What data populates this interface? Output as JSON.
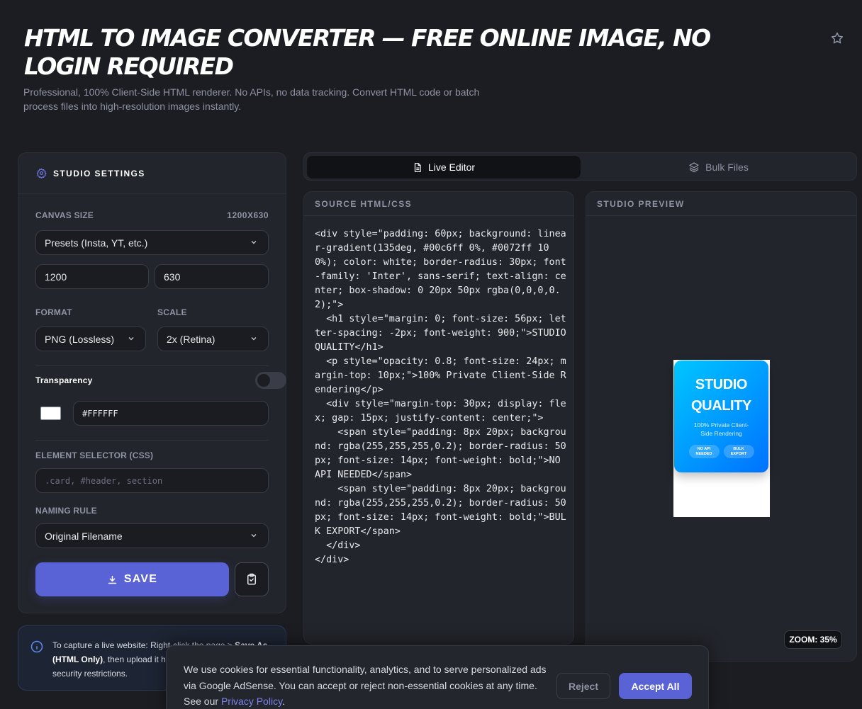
{
  "header": {
    "title": "HTML TO IMAGE CONVERTER — FREE ONLINE IMAGE, NO LOGIN REQUIRED",
    "subtitle": "Professional, 100% Client-Side HTML renderer. No APIs, no data tracking. Convert HTML code or batch process files into high-resolution images instantly.",
    "favorite_icon": "star-icon"
  },
  "settings": {
    "heading": "STUDIO SETTINGS",
    "heading_icon": "gear-icon",
    "canvas_size_label": "CANVAS SIZE",
    "canvas_size_value": "1200X630",
    "preset_select": "Presets (Insta, YT, etc.)",
    "width": "1200",
    "height": "630",
    "format_label": "FORMAT",
    "format_value": "PNG (Lossless)",
    "scale_label": "SCALE",
    "scale_value": "2x (Retina)",
    "transparency_label": "Transparency",
    "transparency_enabled": false,
    "bg_color": "#FFFFFF",
    "selector_label": "ELEMENT SELECTOR (CSS)",
    "selector_placeholder": ".card, #header, section",
    "naming_label": "NAMING RULE",
    "naming_value": "Original Filename",
    "save_label": "SAVE"
  },
  "info": {
    "text_before": "To capture a live website: Right-click the page > ",
    "text_bold": "Save As (HTML Only)",
    "text_after": ", then upload it here. This bypasses CORS security restrictions."
  },
  "tabs": [
    {
      "label": "Live Editor",
      "active": true,
      "icon": "document-icon"
    },
    {
      "label": "Bulk Files",
      "active": false,
      "icon": "layers-icon"
    }
  ],
  "source": {
    "heading": "SOURCE HTML/CSS",
    "code": "<div style=\"padding: 60px; background: linear-gradient(135deg, #00c6ff 0%, #0072ff 100%); color: white; border-radius: 30px; font-family: 'Inter', sans-serif; text-align: center; box-shadow: 0 20px 50px rgba(0,0,0,0.2);\">\n  <h1 style=\"margin: 0; font-size: 56px; letter-spacing: -2px; font-weight: 900;\">STUDIO QUALITY</h1>\n  <p style=\"opacity: 0.8; font-size: 24px; margin-top: 10px;\">100% Private Client-Side Rendering</p>\n  <div style=\"margin-top: 30px; display: flex; gap: 15px; justify-content: center;\">\n    <span style=\"padding: 8px 20px; background: rgba(255,255,255,0.2); border-radius: 50px; font-size: 14px; font-weight: bold;\">NO API NEEDED</span>\n    <span style=\"padding: 8px 20px; background: rgba(255,255,255,0.2); border-radius: 50px; font-size: 14px; font-weight: bold;\">BULK EXPORT</span>\n  </div>\n</div>"
  },
  "preview": {
    "heading": "STUDIO PREVIEW",
    "card_title": "STUDIO QUALITY",
    "card_subtitle": "100% Private Client-Side Rendering",
    "badge_1": "NO API NEEDED",
    "badge_2": "BULK EXPORT",
    "zoom": "ZOOM: 35%"
  },
  "cookie": {
    "message": "We use cookies for essential functionality, analytics, and to serve personalized ads via Google AdSense. You can accept or reject non-essential cookies at any time. See our ",
    "link": "Privacy Policy",
    "end": ".",
    "reject": "Reject",
    "accept": "Accept All"
  },
  "colors": {
    "accent": "#5A63D6",
    "background": "#1C1D22",
    "panel": "#23252C",
    "gradient_start": "#00C6FF",
    "gradient_end": "#0072FF"
  }
}
